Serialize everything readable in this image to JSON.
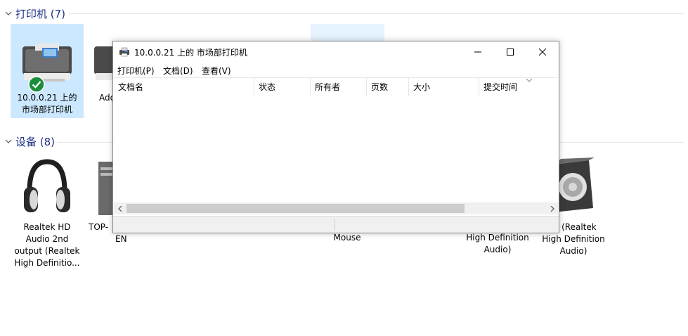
{
  "sections": {
    "printers": {
      "title": "打印机 (7)"
    },
    "devices": {
      "title": "设备 (8)"
    }
  },
  "printers": [
    {
      "label_lines": [
        "10.0.0.21 上的",
        "市场部打印机"
      ],
      "selected": true,
      "default": true
    },
    {
      "label_lines": [
        "Ado"
      ]
    }
  ],
  "devices": [
    {
      "label_lines": [
        "Realtek HD",
        "Audio 2nd",
        "output (Realtek",
        "High Definitio..."
      ]
    },
    {
      "label_lines": [
        "TOP-",
        "EN"
      ]
    },
    {
      "label_lines": [
        "Mouse"
      ]
    },
    {
      "label_lines": [
        "High Definition",
        "Audio)"
      ]
    },
    {
      "label_lines": [
        "器 (Realtek",
        "High Definition",
        "Audio)"
      ]
    }
  ],
  "dialog": {
    "title": "10.0.0.21 上的 市场部打印机",
    "menu": [
      "打印机(P)",
      "文档(D)",
      "查看(V)"
    ],
    "columns": [
      "文档名",
      "状态",
      "所有者",
      "页数",
      "大小",
      "提交时间"
    ],
    "icons": {
      "window": "printer-icon",
      "minimize": "minimize-icon",
      "maximize": "maximize-icon",
      "close": "close-icon"
    }
  }
}
